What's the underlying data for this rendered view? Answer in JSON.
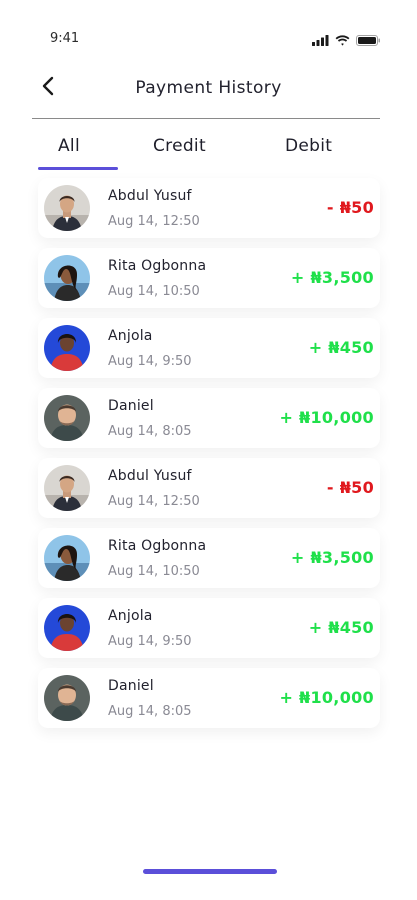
{
  "status_bar": {
    "time": "9:41"
  },
  "header": {
    "title": "Payment History"
  },
  "tabs": [
    {
      "label": "All",
      "active": true
    },
    {
      "label": "Credit",
      "active": false
    },
    {
      "label": "Debit",
      "active": false
    }
  ],
  "colors": {
    "accent": "#5b4fd9",
    "debit": "#e0191e",
    "credit": "#1fe04a"
  },
  "transactions": [
    {
      "name": "Abdul Yusuf",
      "time": "Aug 14, 12:50",
      "amount": "- ₦50",
      "type": "debit",
      "avatar": "avatar-abdul"
    },
    {
      "name": "Rita Ogbonna",
      "time": "Aug 14, 10:50",
      "amount": "+ ₦3,500",
      "type": "credit",
      "avatar": "avatar-rita"
    },
    {
      "name": "Anjola",
      "time": "Aug 14, 9:50",
      "amount": "+ ₦450",
      "type": "credit",
      "avatar": "avatar-anjola"
    },
    {
      "name": "Daniel",
      "time": "Aug 14, 8:05",
      "amount": "+ ₦10,000",
      "type": "credit",
      "avatar": "avatar-daniel"
    },
    {
      "name": "Abdul Yusuf",
      "time": "Aug 14, 12:50",
      "amount": "- ₦50",
      "type": "debit",
      "avatar": "avatar-abdul"
    },
    {
      "name": "Rita Ogbonna",
      "time": "Aug 14, 10:50",
      "amount": "+ ₦3,500",
      "type": "credit",
      "avatar": "avatar-rita"
    },
    {
      "name": "Anjola",
      "time": "Aug 14, 9:50",
      "amount": "+ ₦450",
      "type": "credit",
      "avatar": "avatar-anjola"
    },
    {
      "name": "Daniel",
      "time": "Aug 14, 8:05",
      "amount": "+ ₦10,000",
      "type": "credit",
      "avatar": "avatar-daniel"
    }
  ]
}
